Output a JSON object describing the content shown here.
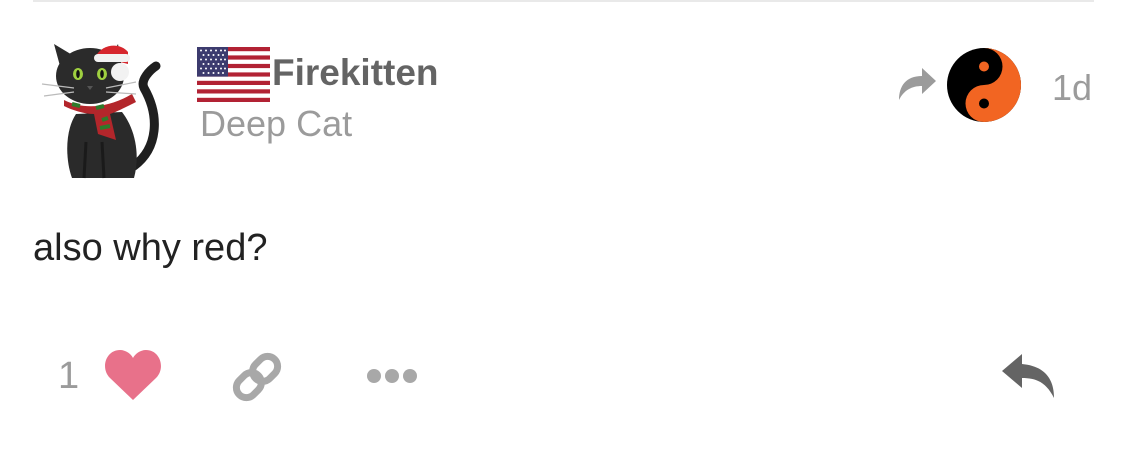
{
  "post": {
    "author": {
      "username": "Firekitten",
      "title": "Deep Cat",
      "flag_icon": "us-flag-icon",
      "avatar": "black-cat-santa-hat-avatar"
    },
    "reply_to": {
      "arrow_icon": "share-arrow-icon",
      "avatar": "yin-yang-avatar"
    },
    "date": "1d",
    "body": "also why red?",
    "actions": {
      "like_count": "1",
      "like_icon": "heart-icon",
      "link_icon": "link-icon",
      "more_icon": "ellipsis-icon",
      "reply_icon": "reply-icon"
    }
  },
  "colors": {
    "like": "#e8718a",
    "username": "#646464",
    "muted": "#9b9b9b",
    "body_text": "#222222",
    "icon_gray": "#a8a8a8",
    "reply_icon": "#646464",
    "yin_yang_orange": "#f26522"
  }
}
